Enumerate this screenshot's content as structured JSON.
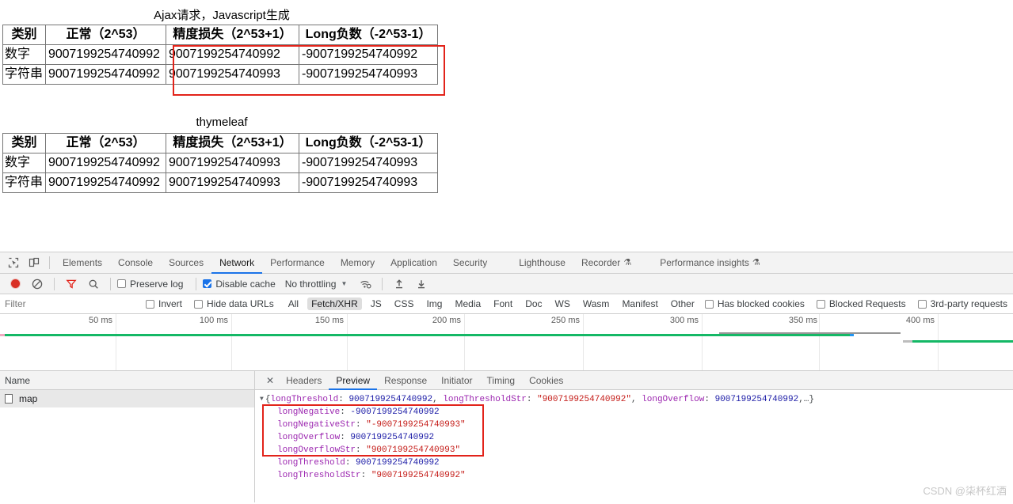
{
  "page": {
    "tables": [
      {
        "title": "Ajax请求，Javascript生成",
        "headers": [
          "类别",
          "正常（2^53）",
          "精度损失（2^53+1）",
          "Long负数（-2^53-1）"
        ],
        "rows": [
          [
            "数字",
            "9007199254740992",
            "9007199254740992",
            "-9007199254740992"
          ],
          [
            "字符串",
            "9007199254740992",
            "9007199254740993",
            "-9007199254740993"
          ]
        ]
      },
      {
        "title": "thymeleaf",
        "headers": [
          "类别",
          "正常（2^53）",
          "精度损失（2^53+1）",
          "Long负数（-2^53-1）"
        ],
        "rows": [
          [
            "数字",
            "9007199254740992",
            "9007199254740993",
            "-9007199254740993"
          ],
          [
            "字符串",
            "9007199254740992",
            "9007199254740993",
            "-9007199254740993"
          ]
        ]
      }
    ]
  },
  "devtools": {
    "panel_tabs": [
      {
        "label": "Elements",
        "active": false,
        "flask": false
      },
      {
        "label": "Console",
        "active": false,
        "flask": false
      },
      {
        "label": "Sources",
        "active": false,
        "flask": false
      },
      {
        "label": "Network",
        "active": true,
        "flask": false
      },
      {
        "label": "Performance",
        "active": false,
        "flask": false
      },
      {
        "label": "Memory",
        "active": false,
        "flask": false
      },
      {
        "label": "Application",
        "active": false,
        "flask": false
      },
      {
        "label": "Security",
        "active": false,
        "flask": false
      },
      {
        "label": "Lighthouse",
        "active": false,
        "flask": false
      },
      {
        "label": "Recorder",
        "active": false,
        "flask": true
      },
      {
        "label": "Performance insights",
        "active": false,
        "flask": true
      }
    ],
    "toolbar": {
      "record_title": "record",
      "clear_title": "clear",
      "filter_title": "filter",
      "search_title": "search",
      "preserve_log_label": "Preserve log",
      "preserve_log_checked": false,
      "disable_cache_label": "Disable cache",
      "disable_cache_checked": true,
      "throttling_label": "No throttling",
      "import_title": "import har",
      "export_title": "export har"
    },
    "filterbar": {
      "filter_placeholder": "Filter",
      "invert_label": "Invert",
      "invert_checked": false,
      "hide_data_urls_label": "Hide data URLs",
      "hide_data_urls_checked": false,
      "types": [
        {
          "label": "All",
          "active": false
        },
        {
          "label": "Fetch/XHR",
          "active": true
        },
        {
          "label": "JS",
          "active": false
        },
        {
          "label": "CSS",
          "active": false
        },
        {
          "label": "Img",
          "active": false
        },
        {
          "label": "Media",
          "active": false
        },
        {
          "label": "Font",
          "active": false
        },
        {
          "label": "Doc",
          "active": false
        },
        {
          "label": "WS",
          "active": false
        },
        {
          "label": "Wasm",
          "active": false
        },
        {
          "label": "Manifest",
          "active": false
        },
        {
          "label": "Other",
          "active": false
        }
      ],
      "has_blocked_cookies_label": "Has blocked cookies",
      "has_blocked_cookies_checked": false,
      "blocked_requests_label": "Blocked Requests",
      "blocked_requests_checked": false,
      "third_party_label": "3rd-party requests",
      "third_party_checked": false
    },
    "overview": {
      "ticks": [
        "50 ms",
        "100 ms",
        "150 ms",
        "200 ms",
        "250 ms",
        "300 ms",
        "350 ms",
        "400 ms"
      ],
      "bars": [
        {
          "color": "#14b866",
          "left_pct": 0.2,
          "width_pct": 83.9,
          "row": 0
        },
        {
          "color": "#969696",
          "left_pct": 89.4,
          "width_pct": 8.6,
          "row": 1
        },
        {
          "color": "#14b866",
          "left_pct": 98.0,
          "width_pct": 2.0,
          "row": 1
        }
      ]
    },
    "requests_panel": {
      "name_column_header": "Name",
      "rows": [
        {
          "name": "map",
          "selected": true
        }
      ]
    },
    "detail_tabs": [
      {
        "label": "Headers",
        "active": false
      },
      {
        "label": "Preview",
        "active": true
      },
      {
        "label": "Response",
        "active": false
      },
      {
        "label": "Initiator",
        "active": false
      },
      {
        "label": "Timing",
        "active": false
      },
      {
        "label": "Cookies",
        "active": false
      }
    ],
    "preview": {
      "summary_prefix": "{",
      "summary": [
        {
          "key": "longThreshold",
          "value": "9007199254740992",
          "type": "number"
        },
        {
          "key": "longThresholdStr",
          "value": "\"9007199254740992\"",
          "type": "string"
        },
        {
          "key": "longOverflow",
          "value": "9007199254740992",
          "type": "number"
        }
      ],
      "summary_suffix": ",…}",
      "entries": [
        {
          "key": "longNegative",
          "value": "-9007199254740992",
          "type": "number",
          "highlighted": true
        },
        {
          "key": "longNegativeStr",
          "value": "\"-9007199254740993\"",
          "type": "string",
          "highlighted": true
        },
        {
          "key": "longOverflow",
          "value": "9007199254740992",
          "type": "number",
          "highlighted": true
        },
        {
          "key": "longOverflowStr",
          "value": "\"9007199254740993\"",
          "type": "string",
          "highlighted": true
        },
        {
          "key": "longThreshold",
          "value": "9007199254740992",
          "type": "number",
          "highlighted": false
        },
        {
          "key": "longThresholdStr",
          "value": "\"9007199254740992\"",
          "type": "string",
          "highlighted": false
        }
      ]
    }
  },
  "watermark": "CSDN @柒杯红酒",
  "colors": {
    "accent": "#1a73e8",
    "record": "#d93025",
    "highlight_box": "#e2231a",
    "timeline_green": "#14b866",
    "timeline_gray": "#969696"
  }
}
